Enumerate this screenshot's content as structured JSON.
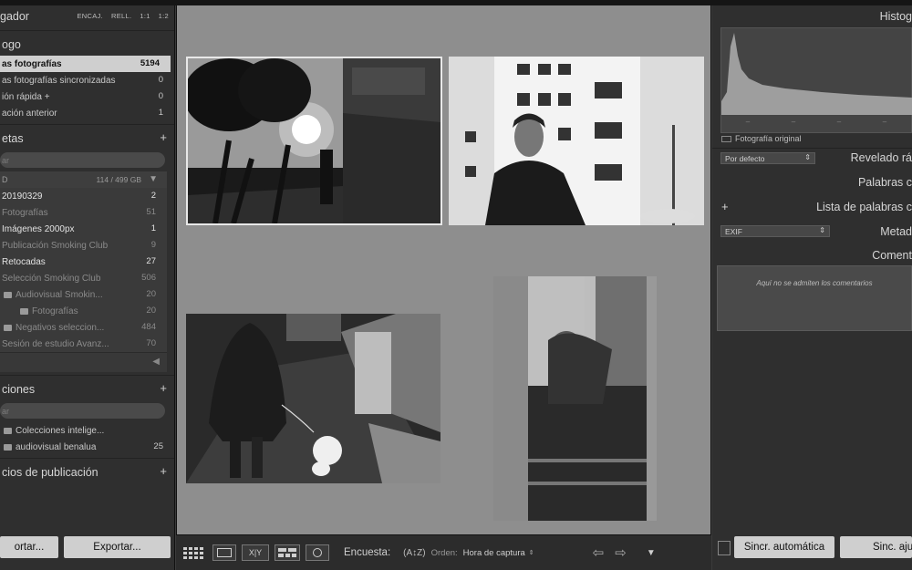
{
  "navigator": {
    "title": "gador",
    "options": [
      "ENCAJ.",
      "RELL.",
      "1:1",
      "1:2"
    ]
  },
  "catalog": {
    "title": "ogo",
    "items": [
      {
        "label": "as fotografías",
        "count": "5194",
        "selected": true
      },
      {
        "label": "as fotografías sincronizadas",
        "count": "0"
      },
      {
        "label": "ión rápida +",
        "count": "0"
      },
      {
        "label": "ación anterior",
        "count": "1"
      }
    ]
  },
  "folders": {
    "title": "etas",
    "search_placeholder": "ar",
    "volume": {
      "label": "D",
      "info": "114 / 499 GB"
    },
    "items": [
      {
        "label": "20190329",
        "count": "2",
        "bright": true
      },
      {
        "label": "Fotografías",
        "count": "51"
      },
      {
        "label": "Imágenes 2000px",
        "count": "1",
        "bright": true
      },
      {
        "label": "Publicación Smoking Club",
        "count": "9"
      },
      {
        "label": "Retocadas",
        "count": "27",
        "bright": true
      },
      {
        "label": "Selección Smoking Club",
        "count": "506"
      },
      {
        "label": "Audiovisual Smokin...",
        "count": "20"
      },
      {
        "label": "Fotografías",
        "count": "20"
      },
      {
        "label": "Negativos seleccion...",
        "count": "484"
      },
      {
        "label": "Sesión de estudio Avanz...",
        "count": "70"
      }
    ]
  },
  "collections": {
    "title": "ciones",
    "search_placeholder": "ar",
    "items": [
      {
        "label": "Colecciones intelige...",
        "count": ""
      },
      {
        "label": "audiovisual benalua",
        "count": "25"
      }
    ]
  },
  "publish": {
    "title": "cios de publicación"
  },
  "left_buttons": {
    "import": "ortar...",
    "export": "Exportar..."
  },
  "toolbar": {
    "survey_label": "Encuesta:",
    "sort_label": "Orden:",
    "sort_value": "Hora de captura",
    "xy": "X|Y"
  },
  "right": {
    "histogram_title": "Histog",
    "original_photo": "Fotografía original",
    "quick_develop": "Revelado rá",
    "quick_develop_preset": "Por defecto",
    "keywords": "Palabras c",
    "keyword_list": "Lista de palabras c",
    "metadata": "Metad",
    "metadata_preset": "EXIF",
    "comments": "Coment",
    "comments_placeholder": "Aquí no se admiten los comentarios",
    "sync_auto": "Sincr. automática",
    "sync": "Sinc. aju"
  }
}
